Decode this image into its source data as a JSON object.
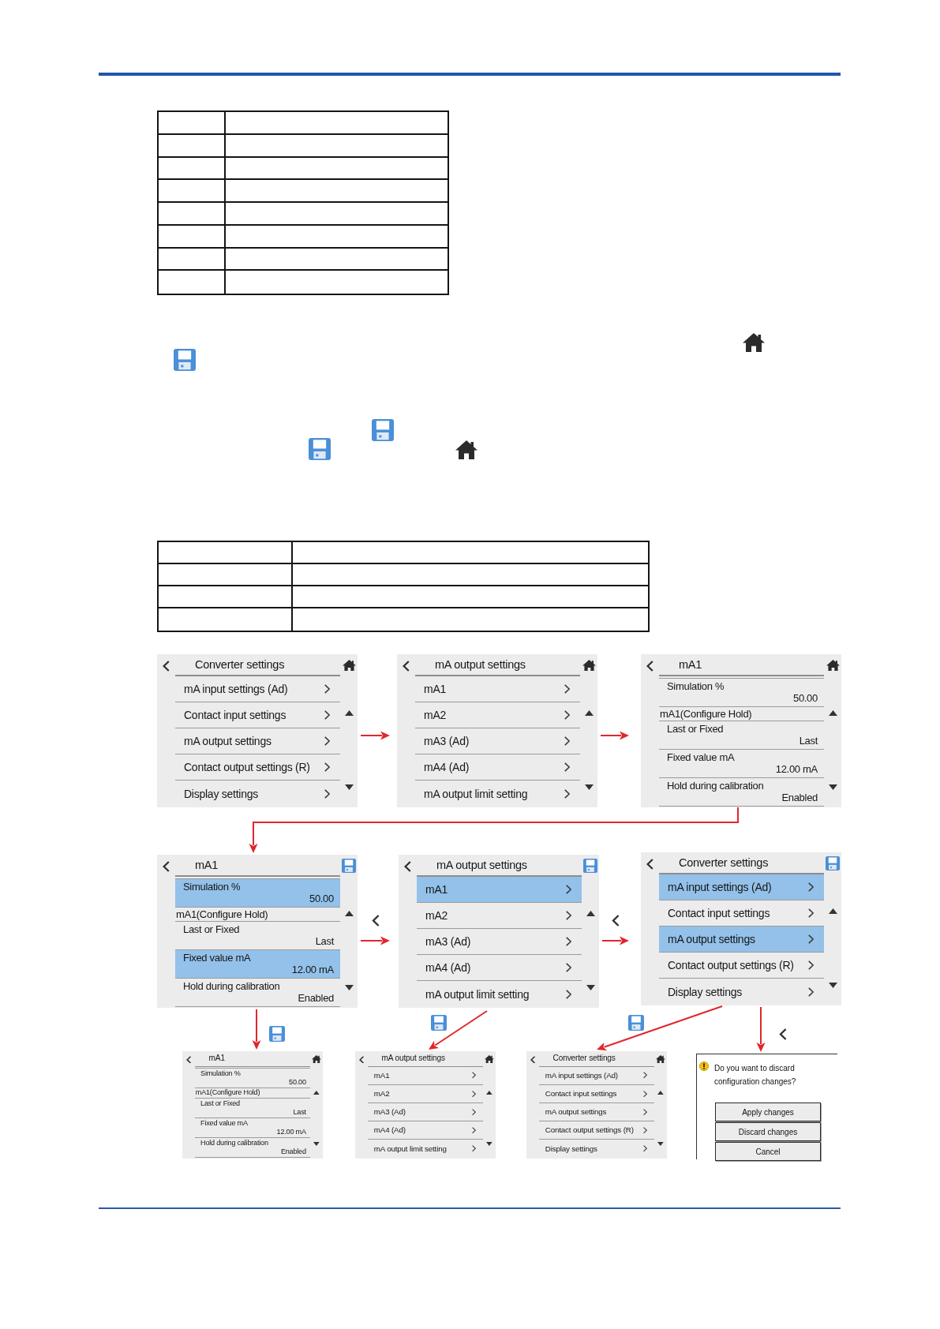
{
  "blank_tables": [
    {
      "rows": [
        {
          "kind": "blank"
        },
        {
          "kind": "blank"
        },
        {
          "kind": "blank"
        },
        {
          "kind": "blank"
        },
        {
          "kind": "blank"
        },
        {
          "kind": "blank"
        },
        {
          "kind": "blank"
        },
        {
          "kind": "blank"
        }
      ]
    },
    {
      "rows": [
        {
          "kind": "blank"
        },
        {
          "kind": "blank"
        },
        {
          "kind": "blank"
        },
        {
          "kind": "blank"
        }
      ]
    }
  ],
  "screens": [
    {
      "kind": "menu",
      "title": "Converter settings",
      "unsaved_changes": false,
      "items": [
        {
          "label": "mA input settings (Ad)",
          "changed": false
        },
        {
          "label": "Contact input settings",
          "changed": false
        },
        {
          "label": "mA output settings",
          "changed": false
        },
        {
          "label": "Contact output settings (R)",
          "changed": false
        },
        {
          "label": "Display settings",
          "changed": false
        }
      ]
    },
    {
      "kind": "menu",
      "title": "mA output settings",
      "unsaved_changes": false,
      "items": [
        {
          "label": "mA1",
          "changed": false
        },
        {
          "label": "mA2",
          "changed": false
        },
        {
          "label": "mA3 (Ad)",
          "changed": false
        },
        {
          "label": "mA4 (Ad)",
          "changed": false
        },
        {
          "label": "mA output limit setting",
          "changed": false
        }
      ]
    },
    {
      "kind": "parameters",
      "title": "mA1",
      "unsaved_changes": false,
      "items": [
        {
          "kind": "param",
          "label": "Simulation %",
          "value": "50.00",
          "changed": false
        },
        {
          "kind": "group",
          "label": "mA1(Configure Hold)"
        },
        {
          "kind": "param",
          "label": "Last or Fixed",
          "value": "Last",
          "changed": false
        },
        {
          "kind": "param",
          "label": "Fixed value mA",
          "value": "12.00 mA",
          "changed": false
        },
        {
          "kind": "param",
          "label": "Hold during calibration",
          "value": "Enabled",
          "changed": false
        }
      ]
    },
    {
      "kind": "parameters",
      "title": "mA1",
      "unsaved_changes": true,
      "items": [
        {
          "kind": "param",
          "label": "Simulation %",
          "value": "50.00",
          "changed": true
        },
        {
          "kind": "group",
          "label": "mA1(Configure Hold)"
        },
        {
          "kind": "param",
          "label": "Last or Fixed",
          "value": "Last",
          "changed": false
        },
        {
          "kind": "param",
          "label": "Fixed value mA",
          "value": "12.00 mA",
          "changed": true
        },
        {
          "kind": "param",
          "label": "Hold during calibration",
          "value": "Enabled",
          "changed": false
        }
      ]
    },
    {
      "kind": "menu",
      "title": "mA output settings",
      "unsaved_changes": true,
      "items": [
        {
          "label": "mA1",
          "changed": true
        },
        {
          "label": "mA2",
          "changed": false
        },
        {
          "label": "mA3 (Ad)",
          "changed": false
        },
        {
          "label": "mA4 (Ad)",
          "changed": false
        },
        {
          "label": "mA output limit setting",
          "changed": false
        }
      ]
    },
    {
      "kind": "menu",
      "title": "Converter settings",
      "unsaved_changes": true,
      "items": [
        {
          "label": "mA input settings (Ad)",
          "changed": true
        },
        {
          "label": "Contact input settings",
          "changed": false
        },
        {
          "label": "mA output settings",
          "changed": true
        },
        {
          "label": "Contact output settings (R)",
          "changed": false
        },
        {
          "label": "Display settings",
          "changed": false
        }
      ]
    },
    {
      "kind": "parameters",
      "title": "mA1",
      "unsaved_changes": false,
      "items": [
        {
          "kind": "param",
          "label": "Simulation %",
          "value": "50.00",
          "changed": false
        },
        {
          "kind": "group",
          "label": "mA1(Configure Hold)"
        },
        {
          "kind": "param",
          "label": "Last or Fixed",
          "value": "Last",
          "changed": false
        },
        {
          "kind": "param",
          "label": "Fixed value mA",
          "value": "12.00 mA",
          "changed": false
        },
        {
          "kind": "param",
          "label": "Hold during calibration",
          "value": "Enabled",
          "changed": false
        }
      ]
    },
    {
      "kind": "menu",
      "title": "mA output settings",
      "unsaved_changes": false,
      "items": [
        {
          "label": "mA1",
          "changed": false
        },
        {
          "label": "mA2",
          "changed": false
        },
        {
          "label": "mA3 (Ad)",
          "changed": false
        },
        {
          "label": "mA4 (Ad)",
          "changed": false
        },
        {
          "label": "mA output limit setting",
          "changed": false
        }
      ]
    },
    {
      "kind": "menu",
      "title": "Converter settings",
      "unsaved_changes": false,
      "items": [
        {
          "label": "mA input settings (Ad)",
          "changed": false
        },
        {
          "label": "Contact input settings",
          "changed": false
        },
        {
          "label": "mA output settings",
          "changed": false
        },
        {
          "label": "Contact output settings (R)",
          "changed": false
        },
        {
          "label": "Display settings",
          "changed": false
        }
      ]
    }
  ],
  "dialog": {
    "message": "Do you want to discard configuration changes?",
    "buttons": [
      {
        "label": "Apply changes"
      },
      {
        "label": "Discard changes"
      },
      {
        "label": "Cancel"
      }
    ]
  }
}
